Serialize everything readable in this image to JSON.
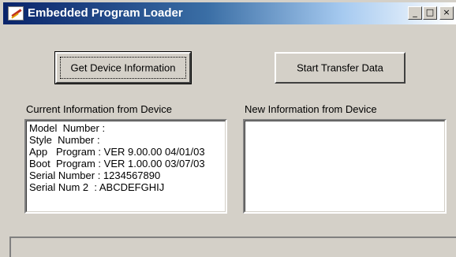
{
  "window": {
    "title": "Embedded Program Loader",
    "buttons": {
      "minimize": "_",
      "maximize": "□",
      "close": "×"
    }
  },
  "toolbar": {
    "get_info_label": "Get Device Information",
    "start_transfer_label": "Start Transfer Data"
  },
  "current": {
    "label": "Current Information from Device",
    "lines": [
      "Model  Number :",
      "Style  Number :",
      "App   Program : VER 9.00.00 04/01/03",
      "Boot  Program : VER 1.00.00 03/07/03",
      "Serial Number : 1234567890",
      "Serial Num 2  : ABCDEFGHIJ"
    ]
  },
  "new_info": {
    "label": "New Information from Device",
    "lines": []
  },
  "status": {
    "text": ""
  },
  "colors": {
    "titlebar_start": "#0a246a",
    "window_bg": "#d4d0c8"
  }
}
